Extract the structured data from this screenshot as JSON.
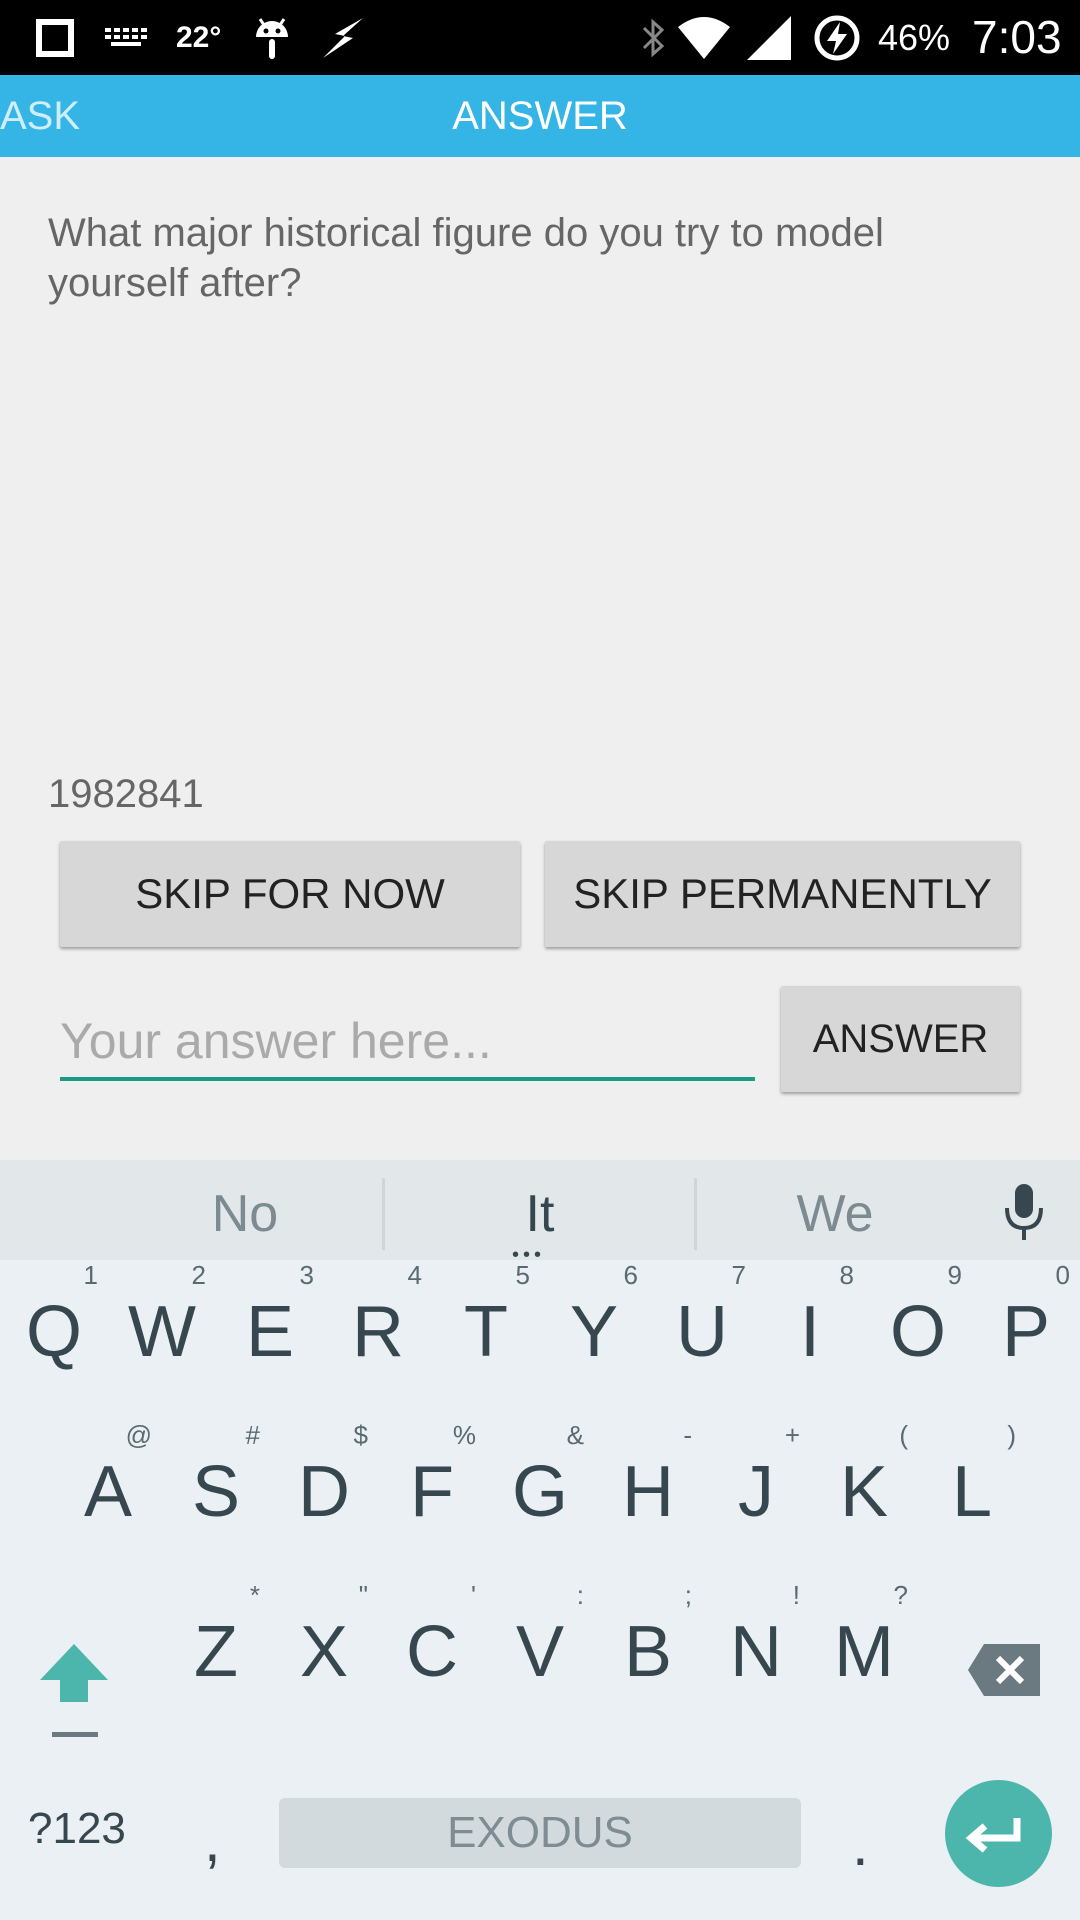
{
  "status_bar": {
    "temperature": "22°",
    "battery": "46%",
    "time": "7:03"
  },
  "tabs": [
    {
      "label": "ASK"
    },
    {
      "label": "ANSWER"
    }
  ],
  "question": "What major historical figure do you try to model yourself after?",
  "question_id": "1982841",
  "buttons": {
    "skip_now": "SKIP FOR NOW",
    "skip_permanently": "SKIP PERMANENTLY",
    "answer": "ANSWER"
  },
  "answer_input": {
    "placeholder": "Your answer here..."
  },
  "keyboard": {
    "suggestions": [
      "No",
      "It",
      "We"
    ],
    "row1": [
      {
        "k": "Q",
        "h": "1"
      },
      {
        "k": "W",
        "h": "2"
      },
      {
        "k": "E",
        "h": "3"
      },
      {
        "k": "R",
        "h": "4"
      },
      {
        "k": "T",
        "h": "5"
      },
      {
        "k": "Y",
        "h": "6"
      },
      {
        "k": "U",
        "h": "7"
      },
      {
        "k": "I",
        "h": "8"
      },
      {
        "k": "O",
        "h": "9"
      },
      {
        "k": "P",
        "h": "0"
      }
    ],
    "row2": [
      {
        "k": "A",
        "h": "@"
      },
      {
        "k": "S",
        "h": "#"
      },
      {
        "k": "D",
        "h": "$"
      },
      {
        "k": "F",
        "h": "%"
      },
      {
        "k": "G",
        "h": "&"
      },
      {
        "k": "H",
        "h": "-"
      },
      {
        "k": "J",
        "h": "+"
      },
      {
        "k": "K",
        "h": "("
      },
      {
        "k": "L",
        "h": ")"
      }
    ],
    "row3": [
      {
        "k": "Z",
        "h": "*"
      },
      {
        "k": "X",
        "h": "\""
      },
      {
        "k": "C",
        "h": "'"
      },
      {
        "k": "V",
        "h": ":"
      },
      {
        "k": "B",
        "h": ";"
      },
      {
        "k": "N",
        "h": "!"
      },
      {
        "k": "M",
        "h": "?"
      }
    ],
    "symbols_key": "?123",
    "comma": ",",
    "period": ".",
    "space_label": "EXODUS"
  },
  "colors": {
    "accent": "#35b5e5",
    "input_underline": "#1b9b86",
    "enter_key": "#4db6ac"
  }
}
